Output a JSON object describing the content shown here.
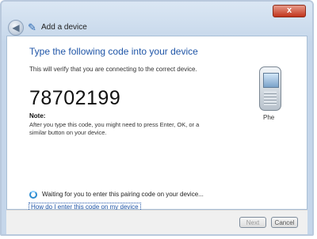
{
  "window": {
    "title": "Add a device",
    "close_label": "x"
  },
  "icons": {
    "back": "back-arrow-icon",
    "title": "bluetooth-icon",
    "device": "phone-icon",
    "status": "spinner-icon",
    "close": "close-icon"
  },
  "main": {
    "heading": "Type the following code into your device",
    "subtext": "This will verify that you are connecting to the correct device.",
    "code": "78702199",
    "note_title": "Note:",
    "note_text": "After you type this code, you might need to press Enter, OK, or a similar button on your device.",
    "device_name": "Phe",
    "status_text": "Waiting for you to enter this pairing code on your device...",
    "help_link": "How do I enter this code on my device"
  },
  "footer": {
    "next_label": "Next",
    "cancel_label": "Cancel"
  }
}
